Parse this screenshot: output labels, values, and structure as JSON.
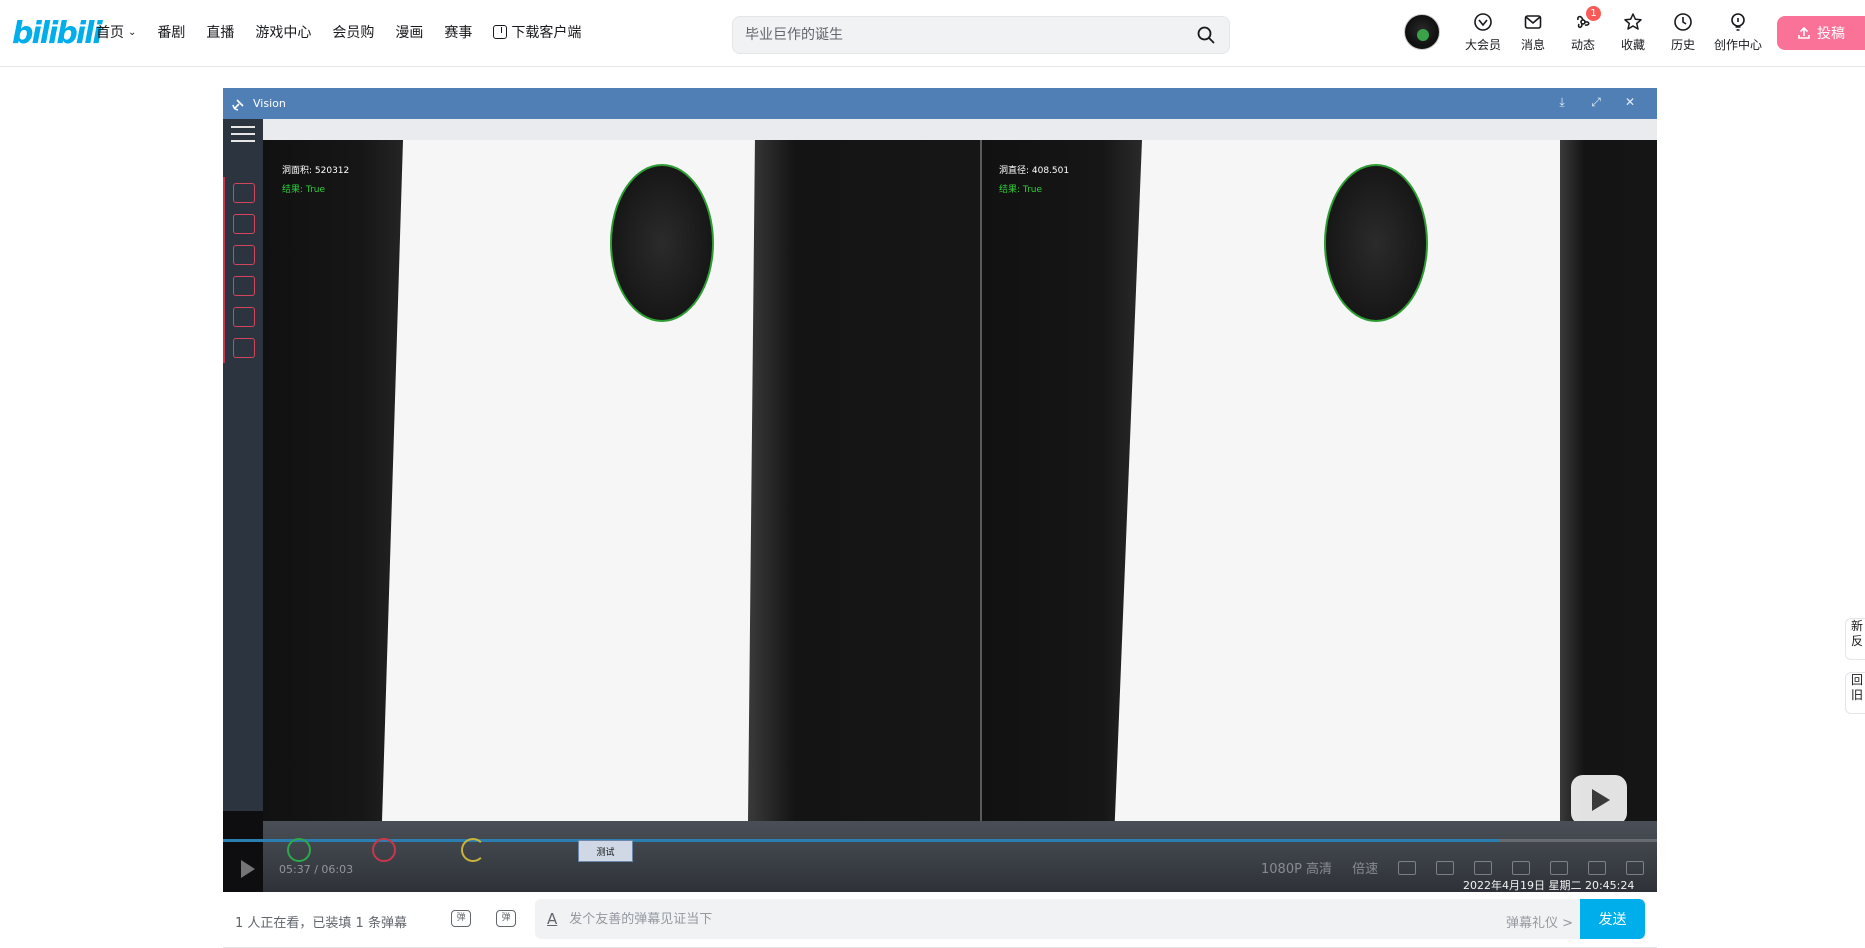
{
  "header": {
    "logo": "bilibili",
    "nav": [
      {
        "label": "首页",
        "has_dropdown": true
      },
      {
        "label": "番剧"
      },
      {
        "label": "直播"
      },
      {
        "label": "游戏中心"
      },
      {
        "label": "会员购"
      },
      {
        "label": "漫画"
      },
      {
        "label": "赛事"
      },
      {
        "label": "下载客户端",
        "icon": "download-icon"
      }
    ],
    "search_placeholder": "毕业巨作的诞生",
    "right_items": [
      {
        "label": "大会员",
        "icon": "vip-icon"
      },
      {
        "label": "消息",
        "icon": "mail-icon"
      },
      {
        "label": "动态",
        "icon": "wind-icon",
        "badge": "1"
      },
      {
        "label": "收藏",
        "icon": "star-icon"
      },
      {
        "label": "历史",
        "icon": "clock-icon"
      },
      {
        "label": "创作中心",
        "icon": "lightbulb-icon"
      }
    ],
    "upload_label": "投稿"
  },
  "player": {
    "app_title": "Vision",
    "left_panel": {
      "line1": "洞面积: 520312",
      "line2_prefix": "结果: ",
      "line2_value": "True"
    },
    "right_panel": {
      "line1": "洞直径: 408.501",
      "line2_prefix": "结果: ",
      "line2_value": "True"
    },
    "test_button": "测试",
    "time_current": "05:37",
    "time_sep": "/",
    "time_total": "06:03",
    "progress": 0.89,
    "quality": "1080P 高清",
    "speed": "倍速",
    "datetime": "2022年4月19日 星期二  20:45:24"
  },
  "danmaku": {
    "viewers_text": "1 人正在看，已装填 1 条弹幕",
    "input_placeholder": "发个友善的弹幕见证当下",
    "etiquette": "弹幕礼仪 >",
    "send": "发送"
  },
  "float_tabs": [
    "新反",
    "回旧"
  ],
  "colors": {
    "accent": "#00aeec",
    "upload": "#fb7299",
    "result_ok": "#2fcf3a",
    "vision_bar": "#4f7fb5"
  }
}
